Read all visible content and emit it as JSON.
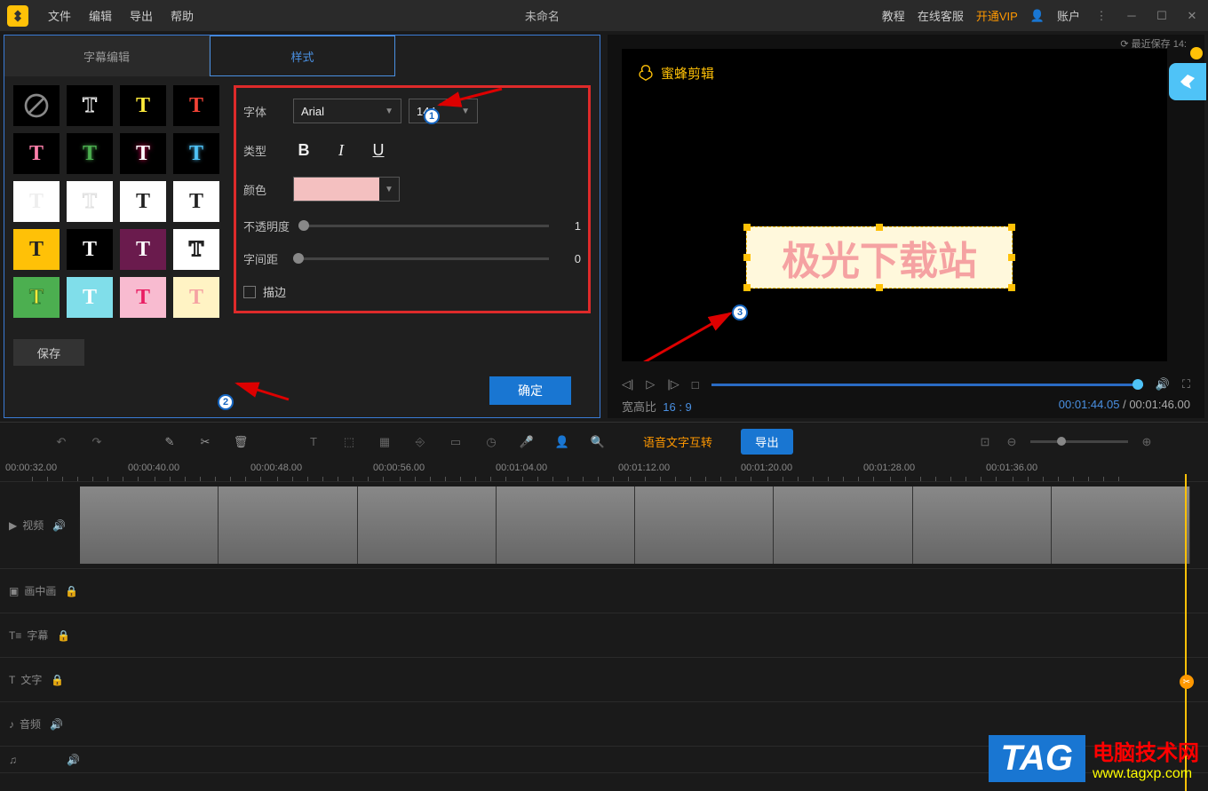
{
  "menu": {
    "file": "文件",
    "edit": "编辑",
    "export": "导出",
    "help": "帮助"
  },
  "title": "未命名",
  "right_menu": {
    "tutorial": "教程",
    "service": "在线客服",
    "vip": "开通VIP",
    "account": "账户"
  },
  "save_status": "最近保存 14:",
  "watermark_text": "蜜蜂剪辑",
  "tabs": {
    "subtitle": "字幕编辑",
    "style": "样式"
  },
  "form": {
    "font_label": "字体",
    "font_value": "Arial",
    "size_value": "144",
    "type_label": "类型",
    "color_label": "颜色",
    "color_value": "#f4c0c0",
    "opacity_label": "不透明度",
    "opacity_value": "1",
    "kerning_label": "字间距",
    "kerning_value": "0",
    "stroke_label": "描边"
  },
  "buttons": {
    "save": "保存",
    "ok": "确定"
  },
  "preview_text": "极光下载站",
  "aspect": {
    "label": "宽高比",
    "value": "16 : 9"
  },
  "time": {
    "current": "00:01:44.05",
    "total": "00:01:46.00"
  },
  "toolbar": {
    "audio_text": "语音文字互转",
    "export": "导出"
  },
  "ruler_marks": [
    "00:00:32.00",
    "00:00:40.00",
    "00:00:48.00",
    "00:00:56.00",
    "00:01:04.00",
    "00:01:12.00",
    "00:01:20.00",
    "00:01:28.00",
    "00:01:36.00"
  ],
  "tracks": {
    "video": "视频",
    "pip": "画中画",
    "subtitle": "字幕",
    "text": "文字",
    "audio": "音频"
  },
  "tag_wm": {
    "tag": "TAG",
    "line1": "电脑技术网",
    "line2": "www.tagxp.com"
  }
}
